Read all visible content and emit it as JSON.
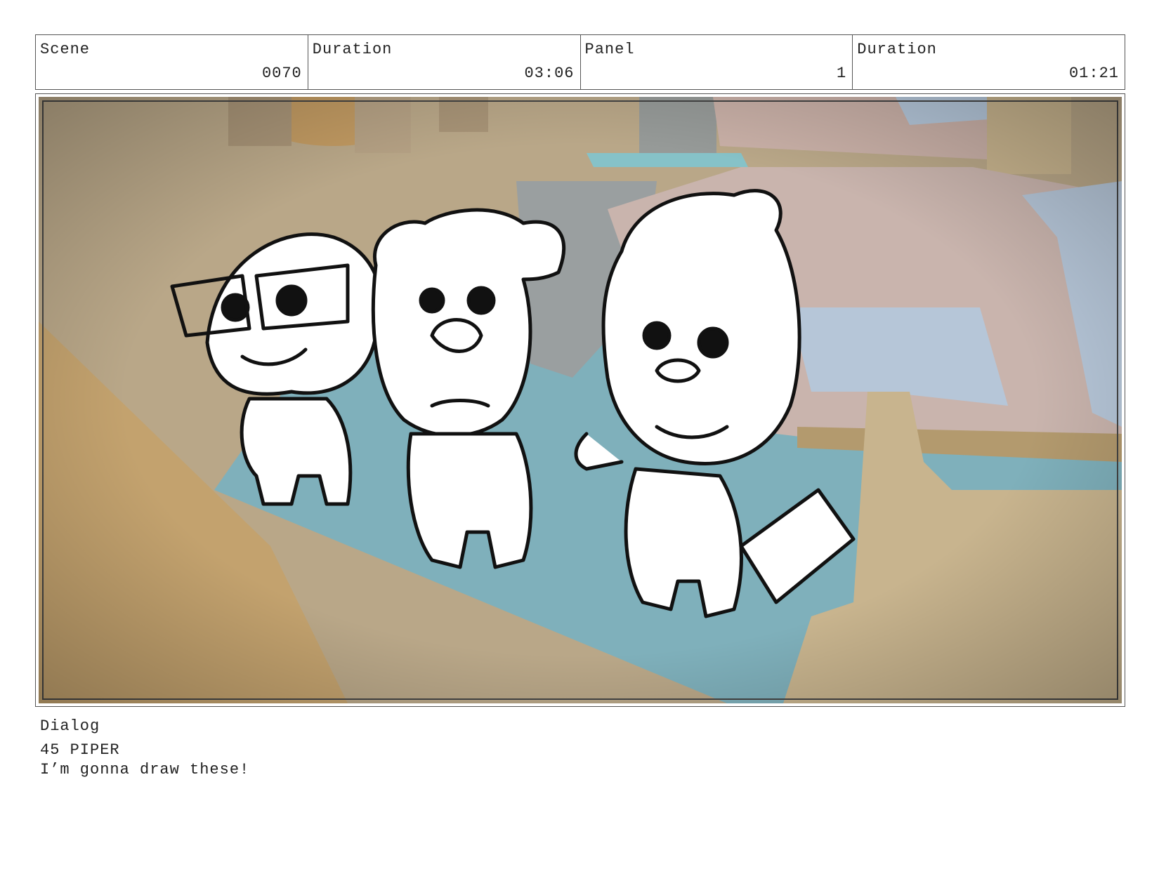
{
  "header": {
    "scene_label": "Scene",
    "scene_value": "0070",
    "scene_duration_label": "Duration",
    "scene_duration_value": "03:06",
    "panel_label": "Panel",
    "panel_value": "1",
    "panel_duration_label": "Duration",
    "panel_duration_value": "01:21"
  },
  "artwork": {
    "description_icon": "storyboard-panel-image",
    "colors": {
      "floor": "#b9a788",
      "rug": "#7fb0bb",
      "bed": "#c9b4ad",
      "sheet": "#b6c6d8",
      "furniture": "#c8b48e"
    }
  },
  "dialog": {
    "label": "Dialog",
    "speaker": "45 PIPER",
    "line": "I’m gonna draw these!"
  }
}
